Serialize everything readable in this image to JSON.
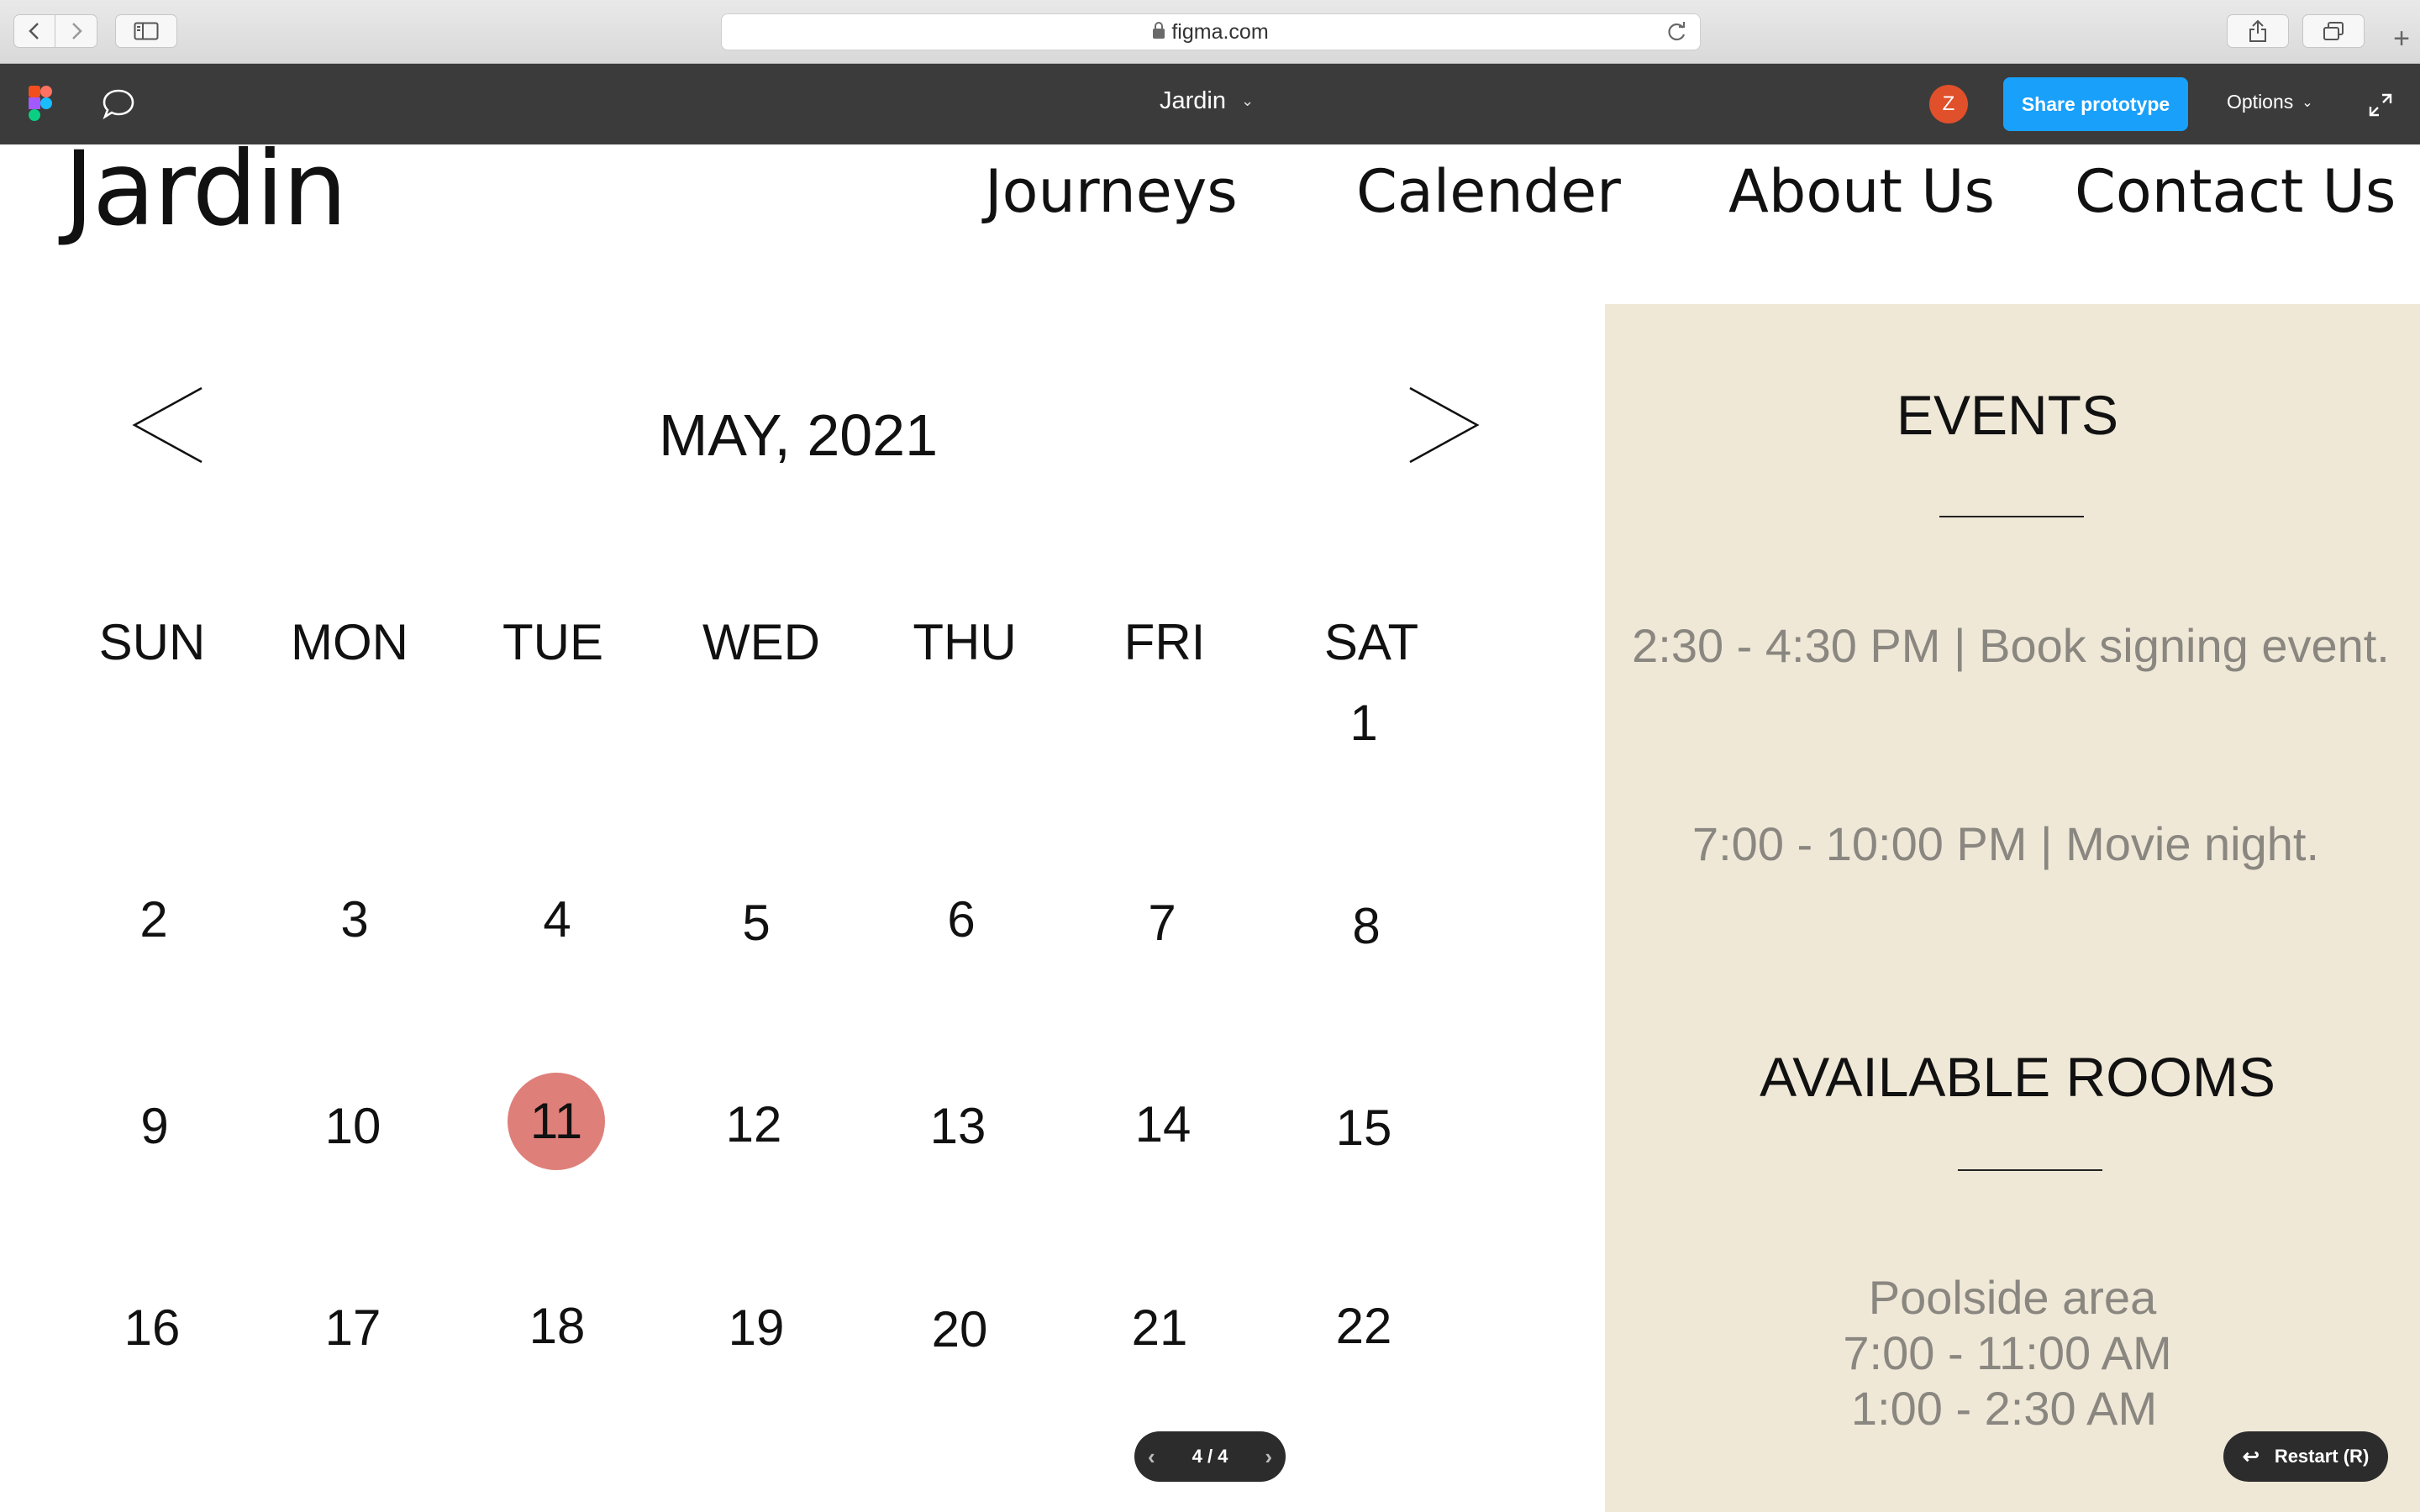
{
  "browser": {
    "url": "figma.com"
  },
  "figma": {
    "file_title": "Jardin",
    "avatar_initial": "Z",
    "share_label": "Share prototype",
    "options_label": "Options"
  },
  "site": {
    "logo": "Jardin",
    "nav": [
      "Journeys",
      "Calender",
      "About Us",
      "Contact Us"
    ]
  },
  "calendar": {
    "month_label": "MAY, 2021",
    "weekdays": [
      "SUN",
      "MON",
      "TUE",
      "WED",
      "THU",
      "FRI",
      "SAT"
    ],
    "weeks": [
      [
        "",
        "",
        "",
        "",
        "",
        "",
        "1"
      ],
      [
        "2",
        "3",
        "4",
        "5",
        "6",
        "7",
        "8"
      ],
      [
        "9",
        "10",
        "11",
        "12",
        "13",
        "14",
        "15"
      ],
      [
        "16",
        "17",
        "18",
        "19",
        "20",
        "21",
        "22"
      ]
    ],
    "selected_day": "11",
    "highlight_color": "#df7f7a"
  },
  "side_panel": {
    "events_heading": "EVENTS",
    "events": [
      "2:30 - 4:30 PM | Book signing event.",
      "7:00 - 10:00 PM | Movie night."
    ],
    "rooms_heading": "AVAILABLE ROOMS",
    "rooms": {
      "name": "Poolside area",
      "times": [
        "7:00 - 11:00 AM",
        "1:00 - 2:30 AM"
      ]
    },
    "background_color": "#efe8d7"
  },
  "prototype": {
    "page_indicator": "4 / 4",
    "restart_label": "Restart (R)"
  }
}
